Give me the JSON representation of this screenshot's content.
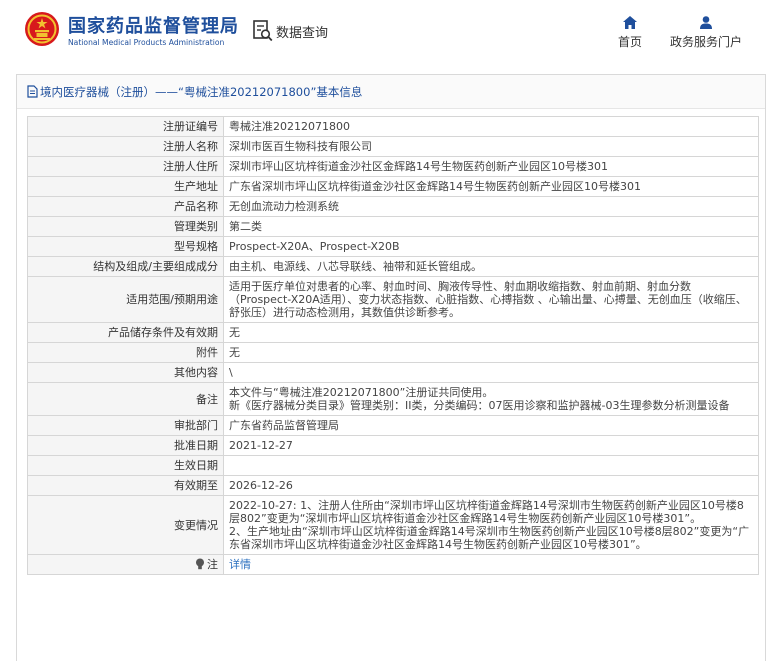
{
  "header": {
    "org_cn": "国家药品监督管理局",
    "org_en": "National Medical Products Administration",
    "data_query": "数据查询",
    "nav": [
      {
        "label": "首页",
        "icon": "home-icon"
      },
      {
        "label": "政务服务门户",
        "icon": "user-icon"
      }
    ],
    "colors": {
      "brand": "#1f4f9c",
      "emblem_red": "#d7191c",
      "emblem_gold": "#f2c230"
    }
  },
  "breadcrumb": "境内医疗器械（注册）——“粤械注准20212071800”基本信息",
  "rows": [
    {
      "label": "注册证编号",
      "value": "粤械注准20212071800"
    },
    {
      "label": "注册人名称",
      "value": "深圳市医百生物科技有限公司"
    },
    {
      "label": "注册人住所",
      "value": "深圳市坪山区坑梓街道金沙社区金辉路14号生物医药创新产业园区10号楼301"
    },
    {
      "label": "生产地址",
      "value": "广东省深圳市坪山区坑梓街道金沙社区金辉路14号生物医药创新产业园区10号楼301"
    },
    {
      "label": "产品名称",
      "value": "无创血流动力检测系统"
    },
    {
      "label": "管理类别",
      "value": "第二类"
    },
    {
      "label": "型号规格",
      "value": "Prospect-X20A、Prospect-X20B"
    },
    {
      "label": "结构及组成/主要组成成分",
      "value": "由主机、电源线、八芯导联线、袖带和延长管组成。"
    },
    {
      "label": "适用范围/预期用途",
      "value": "适用于医疗单位对患者的心率、射血时间、胸液传导性、射血期收缩指数、射血前期、射血分数（Prospect-X20A适用）、变力状态指数、心脏指数、心搏指数 、心输出量、心搏量、无创血压（收缩压、舒张压）进行动态检测用，其数值供诊断参考。"
    },
    {
      "label": "产品储存条件及有效期",
      "value": "无"
    },
    {
      "label": "附件",
      "value": "无"
    },
    {
      "label": "其他内容",
      "value": "\\"
    },
    {
      "label": "备注",
      "lines": [
        "本文件与“粤械注准20212071800”注册证共同使用。",
        "新《医疗器械分类目录》管理类别：II类，分类编码：07医用诊察和监护器械-03生理参数分析测量设备"
      ]
    },
    {
      "label": "审批部门",
      "value": "广东省药品监督管理局"
    },
    {
      "label": "批准日期",
      "value": "2021-12-27"
    },
    {
      "label": "生效日期",
      "value": ""
    },
    {
      "label": "有效期至",
      "value": "2026-12-26"
    },
    {
      "label": "变更情况",
      "lines": [
        "2022-10-27: 1、注册人住所由“深圳市坪山区坑梓街道金辉路14号深圳市生物医药创新产业园区10号楼8层802”变更为“深圳市坪山区坑梓街道金沙社区金辉路14号生物医药创新产业园区10号楼301”。",
        "2、生产地址由“深圳市坪山区坑梓街道金辉路14号深圳市生物医药创新产业园区10号楼8层802”变更为“广东省深圳市坪山区坑梓街道金沙社区金辉路14号生物医药创新产业园区10号楼301”。"
      ]
    },
    {
      "label": "注",
      "icon": "lightbulb-icon",
      "value": "详情",
      "link": true
    }
  ]
}
